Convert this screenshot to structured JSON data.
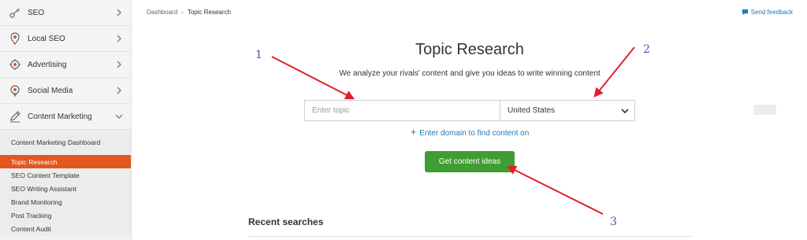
{
  "sidebar": {
    "items": [
      {
        "label": "SEO",
        "icon": "key-icon"
      },
      {
        "label": "Local SEO",
        "icon": "location-pin-icon"
      },
      {
        "label": "Advertising",
        "icon": "target-icon"
      },
      {
        "label": "Social Media",
        "icon": "social-pin-icon"
      },
      {
        "label": "Content Marketing",
        "icon": "pencil-icon"
      }
    ],
    "submenu": [
      "Content Marketing Dashboard",
      "Topic Research",
      "SEO Content Template",
      "SEO Writing Assistant",
      "Brand Monitoring",
      "Post Tracking",
      "Content Audit"
    ],
    "active_submenu": "Topic Research"
  },
  "breadcrumb": {
    "root": "Dashboard",
    "current": "Topic Research"
  },
  "feedback": {
    "label": "Send feedback",
    "icon": "speech-bubble-icon"
  },
  "main": {
    "title": "Topic Research",
    "subtitle": "We analyze your rivals' content and give you ideas to write winning content",
    "topic_placeholder": "Enter topic",
    "country": "United States",
    "domain_link": "Enter domain to find content on",
    "cta": "Get content ideas",
    "recent_title": "Recent searches"
  },
  "annotations": {
    "n1": "1",
    "n2": "2",
    "n3": "3"
  },
  "colors": {
    "accent_orange": "#e2571e",
    "cta_green": "#3f9e33",
    "link_blue": "#1f79b8",
    "arrow_red": "#e0202a",
    "annotation_blue": "#3c5ea8"
  }
}
